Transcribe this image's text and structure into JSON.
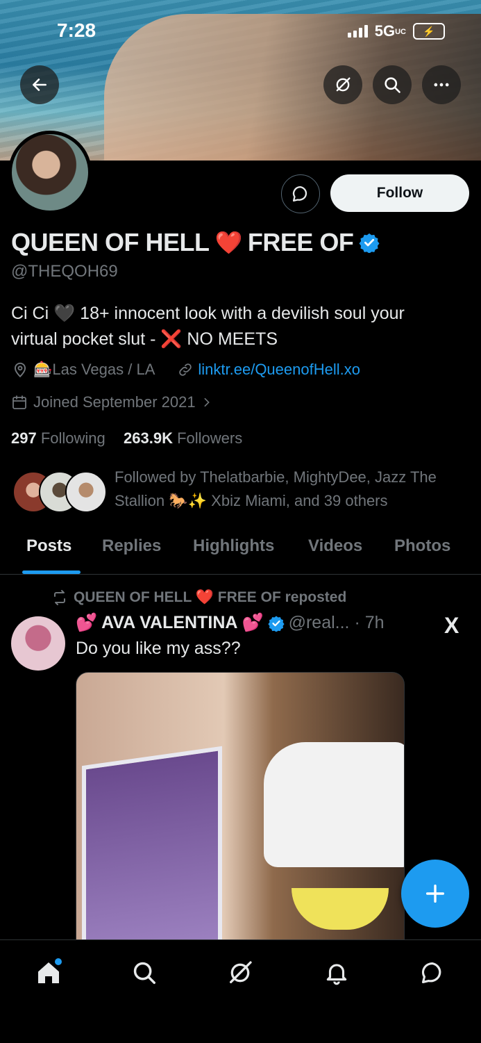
{
  "status_bar": {
    "time": "7:28",
    "network": "5G",
    "network_sub": "UC"
  },
  "profile": {
    "display_name": "QUEEN OF HELL",
    "name_emoji": "❤️",
    "name_suffix": "FREE OF",
    "handle": "@THEQOH69",
    "bio_line1": "Ci Ci 🖤 18+ innocent look with a devilish soul your",
    "bio_line2": "virtual pocket slut - ❌ NO MEETS",
    "location": "🎰Las Vegas / LA",
    "link": "linktr.ee/QueenofHell.xo",
    "joined": "Joined September 2021",
    "following_count": "297",
    "following_label": "Following",
    "followers_count": "263.9K",
    "followers_label": "Followers",
    "followed_by_line1": "Followed by Thelatbarbie, MightyDee, Jazz The",
    "followed_by_line2": "Stallion 🐎✨ Xbiz Miami, and 39 others",
    "follow_label": "Follow"
  },
  "tabs": [
    {
      "label": "Posts"
    },
    {
      "label": "Replies"
    },
    {
      "label": "Highlights"
    },
    {
      "label": "Videos"
    },
    {
      "label": "Photos"
    }
  ],
  "post": {
    "repost_label": "QUEEN OF HELL ❤️ FREE OF reposted",
    "author": "💕 AVA VALENTINA 💕",
    "meta": "@real... · 7h",
    "x_logo": "X",
    "text": "Do you like my ass??"
  },
  "colors": {
    "accent": "#1d9bf0",
    "muted": "#71767b",
    "text": "#e7e9ea",
    "background": "#000000"
  },
  "icons": {
    "back": "arrow-left-icon",
    "grok": "grok-icon",
    "search": "search-icon",
    "more": "more-icon",
    "message": "message-icon",
    "location": "location-pin-icon",
    "link": "link-icon",
    "calendar": "calendar-icon",
    "repost": "repost-icon",
    "compose": "plus-icon",
    "nav": [
      "home-icon",
      "search-icon",
      "grok-icon",
      "bell-icon",
      "message-icon"
    ]
  }
}
